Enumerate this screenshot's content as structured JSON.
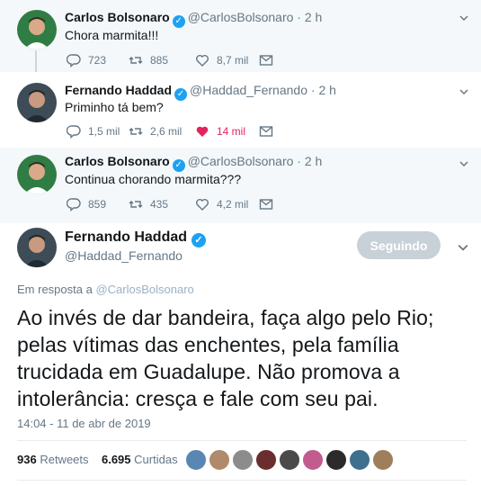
{
  "replies": [
    {
      "name": "Carlos Bolsonaro",
      "handle": "@CarlosBolsonaro",
      "time": "2 h",
      "text": "Chora marmita!!!",
      "replies_count": "723",
      "retweets": "885",
      "likes": "8,7 mil",
      "liked": false
    },
    {
      "name": "Fernando Haddad",
      "handle": "@Haddad_Fernando",
      "time": "2 h",
      "text": "Priminho tá bem?",
      "replies_count": "1,5 mil",
      "retweets": "2,6 mil",
      "likes": "14 mil",
      "liked": true
    },
    {
      "name": "Carlos Bolsonaro",
      "handle": "@CarlosBolsonaro",
      "time": "2 h",
      "text": "Continua chorando marmita???",
      "replies_count": "859",
      "retweets": "435",
      "likes": "4,2 mil",
      "liked": false
    }
  ],
  "main": {
    "name": "Fernando Haddad",
    "handle": "@Haddad_Fernando",
    "follow_label": "Seguindo",
    "reply_prefix": "Em resposta a",
    "reply_to": "@CarlosBolsonaro",
    "text": "Ao invés de dar bandeira, faça algo pelo Rio; pelas vítimas das enchentes, pela família trucidada em Guadalupe. Não promova a intolerância: cresça e fale com seu pai.",
    "date": "14:04 - 11 de abr de 2019",
    "retweets_count": "936",
    "retweets_label": "Retweets",
    "likes_count": "6.695",
    "likes_label": "Curtidas"
  },
  "colors": {
    "link_blue": "#1da1f2",
    "like_red": "#e0245e",
    "muted": "#657786",
    "thread_bg": "#f5f8fa"
  },
  "icons": [
    "reply-icon",
    "retweet-icon",
    "heart-icon",
    "message-icon",
    "chevron-down-icon",
    "verified-icon"
  ]
}
